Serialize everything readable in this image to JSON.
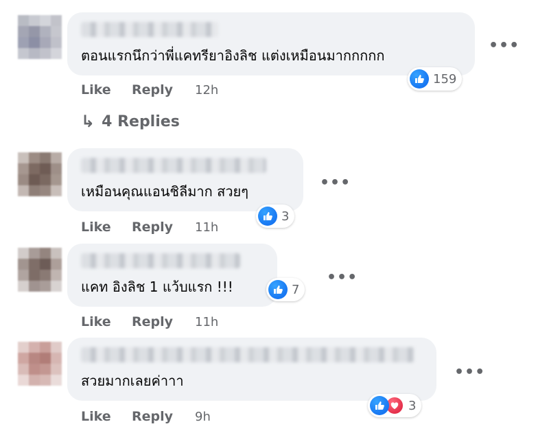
{
  "comments": [
    {
      "text": "ตอนแรกนึกว่าพี่แคทรียาอิงลิช แต่งเหมือนมากกกกก",
      "reaction_count": "159",
      "like_label": "Like",
      "reply_label": "Reply",
      "time": "12h",
      "more_label": "•••",
      "avatar_colors": [
        "#b9bcc4",
        "#c8cad1",
        "#d3d5db",
        "#c2c3ca",
        "#a4a6b4",
        "#9597a8",
        "#b0b2be",
        "#c6c7ce",
        "#9ea1b3",
        "#8c8fa5",
        "#a8a9b8",
        "#c0c1ca",
        "#c5c7cf",
        "#b7b9c4",
        "#c1c2cb",
        "#d4d5db"
      ]
    },
    {
      "text": "เหมือนคุณแอนชิลีมาก สวยๆ",
      "reaction_count": "3",
      "like_label": "Like",
      "reply_label": "Reply",
      "time": "11h",
      "more_label": "•••",
      "avatar_colors": [
        "#c9c0bb",
        "#9c8c84",
        "#8a7a72",
        "#b8aca6",
        "#a69790",
        "#7d6a62",
        "#6f5c55",
        "#9e8f88",
        "#9b8b84",
        "#6e5b54",
        "#7b6961",
        "#a5978f",
        "#c3b8b3",
        "#8f7f78",
        "#978780",
        "#c8beb9"
      ]
    },
    {
      "text": "แคท อิงลิช 1 แว้บแรก !!!",
      "reaction_count": "7",
      "like_label": "Like",
      "reply_label": "Reply",
      "time": "11h",
      "more_label": "•••",
      "avatar_colors": [
        "#d2ccca",
        "#a89c98",
        "#94857f",
        "#c9c1be",
        "#a29590",
        "#7f6e68",
        "#6d5c57",
        "#ad9f9a",
        "#b0a4a0",
        "#7e6d67",
        "#8a7a74",
        "#c0b5b1",
        "#d6d0ce",
        "#a09390",
        "#a99d99",
        "#d8d3d1"
      ]
    },
    {
      "text": "สวยมากเลยค่าาา",
      "reaction_count": "3",
      "like_label": "Like",
      "reply_label": "Reply",
      "time": "9h",
      "more_label": "•••",
      "avatar_colors": [
        "#e3cfcc",
        "#d4b1ad",
        "#c99f9a",
        "#e0cbc8",
        "#cfa7a2",
        "#b88782",
        "#b17d78",
        "#d6b6b2",
        "#d9bcb8",
        "#bf8f8a",
        "#c39792",
        "#dcc2be",
        "#ead9d7",
        "#d3b2ae",
        "#d7b9b5",
        "#eadcda"
      ]
    }
  ],
  "replies_label": "4 Replies",
  "replies_arrow": "↳",
  "colors": {
    "bubble": "#f0f2f5",
    "meta_text": "#65676b",
    "like_blue": "#1877f2",
    "love_red": "#e4304b"
  },
  "icons": [
    "like-icon",
    "love-icon",
    "reply-arrow-icon",
    "more-options-icon"
  ]
}
